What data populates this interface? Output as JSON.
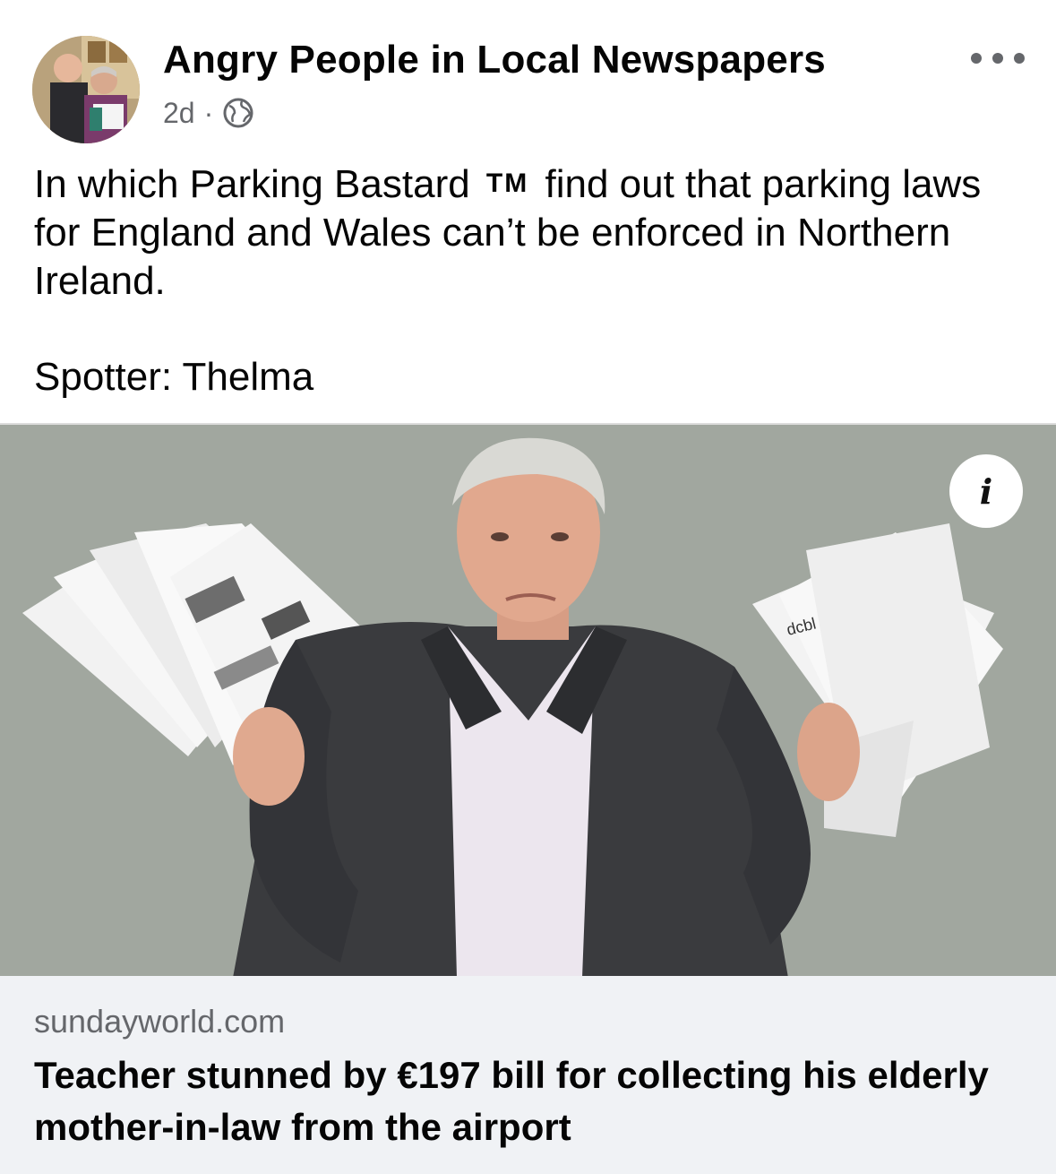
{
  "header": {
    "page_name": "Angry People in Local Newspapers",
    "time": "2d",
    "separator": "·",
    "privacy_icon": "globe-icon",
    "more_icon": "more-options-icon"
  },
  "post": {
    "text_before_tm": "In which Parking Bastard",
    "tm": "TM",
    "text_after_tm": "find out that parking laws for England and Wales can’t be enforced in Northern Ireland.",
    "spotter": "Spotter: Thelma"
  },
  "link": {
    "info_label": "i",
    "domain": "sundayworld.com",
    "title": "Teacher stunned by €197 bill for collecting his elderly mother-in-law from the airport",
    "image_text": "dcbl"
  }
}
